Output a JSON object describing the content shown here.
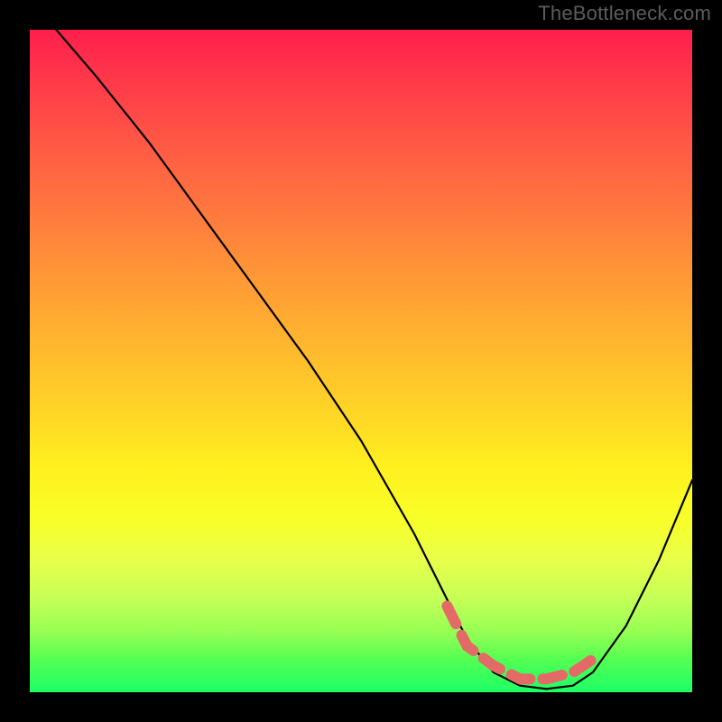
{
  "attribution": "TheBottleneck.com",
  "chart_data": {
    "type": "line",
    "title": "",
    "xlabel": "",
    "ylabel": "",
    "xlim": [
      0,
      100
    ],
    "ylim": [
      0,
      100
    ],
    "grid": false,
    "legend": false,
    "series": [
      {
        "name": "bottleneck-curve",
        "color": "#000000",
        "x": [
          4,
          10,
          18,
          26,
          34,
          42,
          50,
          58,
          63,
          66,
          70,
          74,
          78,
          82,
          85,
          90,
          95,
          100
        ],
        "y": [
          100,
          93,
          83,
          72,
          61,
          50,
          38,
          24,
          14,
          8,
          3,
          1,
          0.5,
          1,
          3,
          10,
          20,
          32
        ]
      },
      {
        "name": "optimal-band",
        "color": "#e46a67",
        "style": "dashed-thick",
        "x": [
          63,
          66,
          70,
          74,
          78,
          82,
          85
        ],
        "y": [
          13,
          7,
          4,
          2,
          2,
          3,
          5
        ]
      }
    ],
    "background_gradient": {
      "top": "#ff1f4d",
      "mid": "#ffe020",
      "bottom": "#1dff66"
    }
  }
}
